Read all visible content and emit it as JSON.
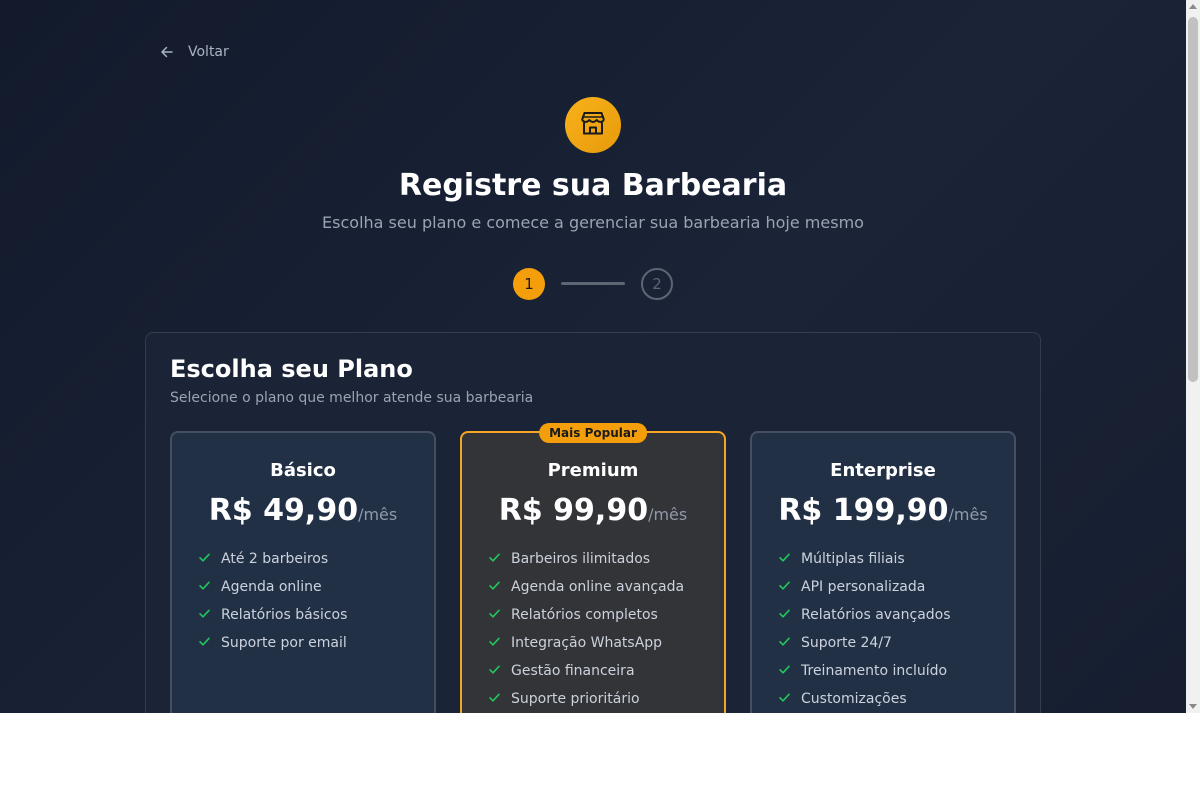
{
  "nav": {
    "back_label": "Voltar"
  },
  "header": {
    "title": "Registre sua Barbearia",
    "subtitle": "Escolha seu plano e comece a gerenciar sua barbearia hoje mesmo"
  },
  "steps": [
    "1",
    "2"
  ],
  "plans_section": {
    "title": "Escolha seu Plano",
    "subtitle": "Selecione o plano que melhor atende sua barbearia",
    "plans": [
      {
        "name": "Básico",
        "price": "R$ 49,90",
        "period": "/mês",
        "features": [
          "Até 2 barbeiros",
          "Agenda online",
          "Relatórios básicos",
          "Suporte por email"
        ]
      },
      {
        "name": "Premium",
        "badge": "Mais Popular",
        "price": "R$ 99,90",
        "period": "/mês",
        "features": [
          "Barbeiros ilimitados",
          "Agenda online avançada",
          "Relatórios completos",
          "Integração WhatsApp",
          "Gestão financeira",
          "Suporte prioritário"
        ]
      },
      {
        "name": "Enterprise",
        "price": "R$ 199,90",
        "period": "/mês",
        "features": [
          "Múltiplas filiais",
          "API personalizada",
          "Relatórios avançados",
          "Suporte 24/7",
          "Treinamento incluído",
          "Customizações"
        ]
      }
    ]
  },
  "colors": {
    "accent": "#f59e0b",
    "check": "#22c55e",
    "background": "#151d2f",
    "card": "#223046"
  },
  "icons": {
    "back": "arrow-left-icon",
    "logo": "store-icon",
    "feature": "check-icon"
  }
}
